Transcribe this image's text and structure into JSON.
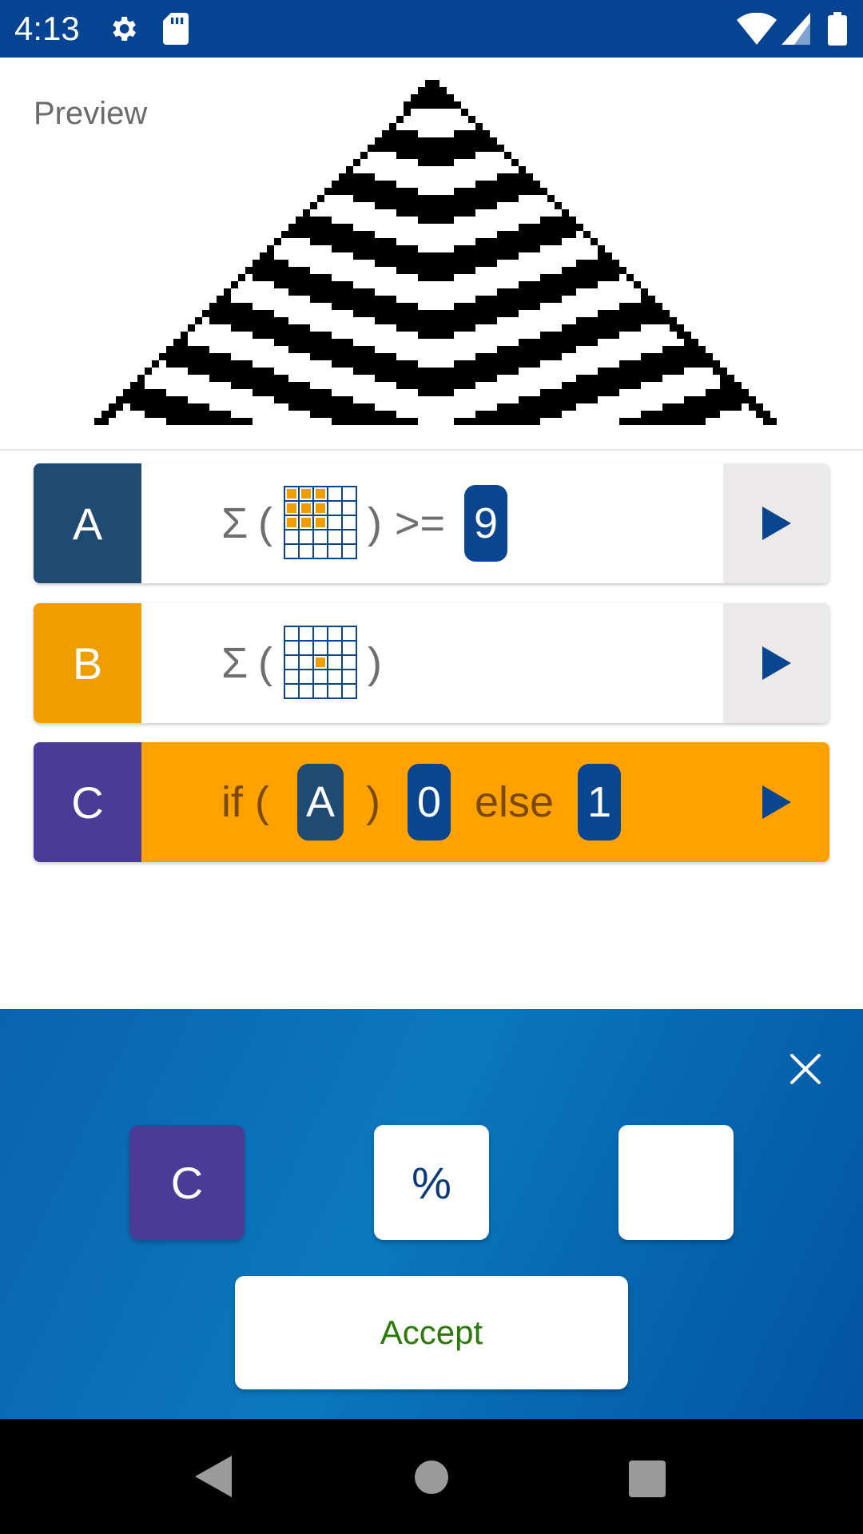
{
  "status_bar": {
    "time": "4:13",
    "icons": [
      "gear-icon",
      "sd-card-icon",
      "wifi-icon",
      "signal-icon",
      "battery-icon"
    ],
    "background": "#044492"
  },
  "preview": {
    "label": "Preview"
  },
  "rules": [
    {
      "letter": "A",
      "letter_color": "#1f4b73",
      "sigma": "Σ",
      "open_paren": "(",
      "close_paren": ")",
      "operator": ">=",
      "threshold": "9",
      "grid_selected_cells": [
        [
          0,
          0
        ],
        [
          0,
          1
        ],
        [
          0,
          2
        ],
        [
          1,
          0
        ],
        [
          1,
          1
        ],
        [
          1,
          2
        ],
        [
          2,
          0
        ],
        [
          2,
          1
        ],
        [
          2,
          2
        ]
      ]
    },
    {
      "letter": "B",
      "letter_color": "#f09d00",
      "sigma": "Σ",
      "open_paren": "(",
      "close_paren": ")",
      "grid_selected_cells": [
        [
          2,
          2
        ]
      ]
    },
    {
      "letter": "C",
      "letter_color": "#4a3c96",
      "body_color": "#ffa200",
      "if_text": "if (",
      "condition": "A",
      "close_paren": ")",
      "then_value": "0",
      "else_text": "else",
      "else_value": "1"
    }
  ],
  "keyboard": {
    "keys": [
      {
        "label": "C",
        "color": "#4a3c96"
      },
      {
        "label": "%",
        "color": "#ffffff"
      },
      {
        "label": "",
        "color": "#ffffff"
      }
    ],
    "accept_label": "Accept",
    "close_icon": "close-icon"
  },
  "nav_bar": {
    "icons": [
      "back-icon",
      "home-icon",
      "recents-icon"
    ]
  },
  "colors": {
    "accent_blue": "#044492",
    "chip_blue": "#0a4590",
    "grid_orange": "#f09d00"
  }
}
